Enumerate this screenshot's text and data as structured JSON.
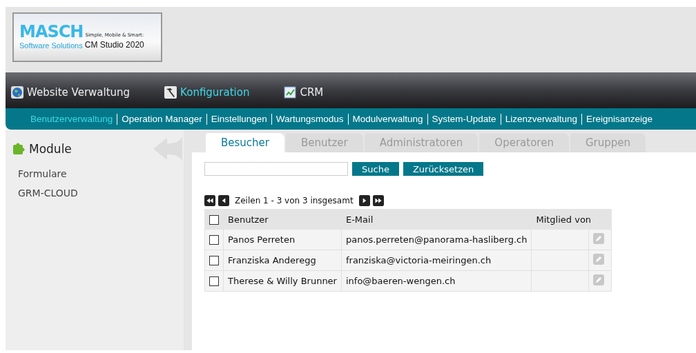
{
  "logo": {
    "title": "MASCH",
    "tagline": "Simple, Mobile & Smart:",
    "subtitle": "Software Solutions",
    "product": "CM Studio 2020"
  },
  "main_nav": [
    {
      "label": "Website Verwaltung",
      "kind": "globe",
      "selected": false
    },
    {
      "label": "Konfiguration",
      "kind": "hammer",
      "selected": true
    },
    {
      "label": "CRM",
      "kind": "chart",
      "selected": false
    }
  ],
  "sub_nav": [
    {
      "label": "Benutzerverwaltung",
      "selected": true
    },
    {
      "label": "Operation Manager",
      "selected": false
    },
    {
      "label": "Einstellungen",
      "selected": false
    },
    {
      "label": "Wartungsmodus",
      "selected": false
    },
    {
      "label": "Modulverwaltung",
      "selected": false
    },
    {
      "label": "System-Update",
      "selected": false
    },
    {
      "label": "Lizenzverwaltung",
      "selected": false
    },
    {
      "label": "Ereignisanzeige",
      "selected": false
    }
  ],
  "sidebar": {
    "title": "Module",
    "items": [
      "Formulare",
      "GRM-CLOUD"
    ]
  },
  "tabs": [
    {
      "label": "Besucher",
      "selected": true
    },
    {
      "label": "Benutzer",
      "selected": false
    },
    {
      "label": "Administratoren",
      "selected": false
    },
    {
      "label": "Operatoren",
      "selected": false
    },
    {
      "label": "Gruppen",
      "selected": false
    }
  ],
  "search": {
    "buttons": [
      "Suche",
      "Zurücksetzen"
    ]
  },
  "pager": {
    "text": "Zeilen 1 - 3 von 3 insgesamt"
  },
  "table": {
    "select_all": {
      "checked": false
    },
    "columns": [
      "Benutzer",
      "E-Mail",
      "Mitglied von"
    ],
    "rows": [
      {
        "checked": false,
        "user": "Panos Perreten",
        "email": "panos.perreten@panorama-hasliberg.ch"
      },
      {
        "checked": false,
        "user": "Franziska Anderegg",
        "email": "franziska@victoria-meiringen.ch"
      },
      {
        "checked": false,
        "user": "Therese & Willy Brunner",
        "email": "info@baeren-wengen.ch"
      }
    ]
  }
}
